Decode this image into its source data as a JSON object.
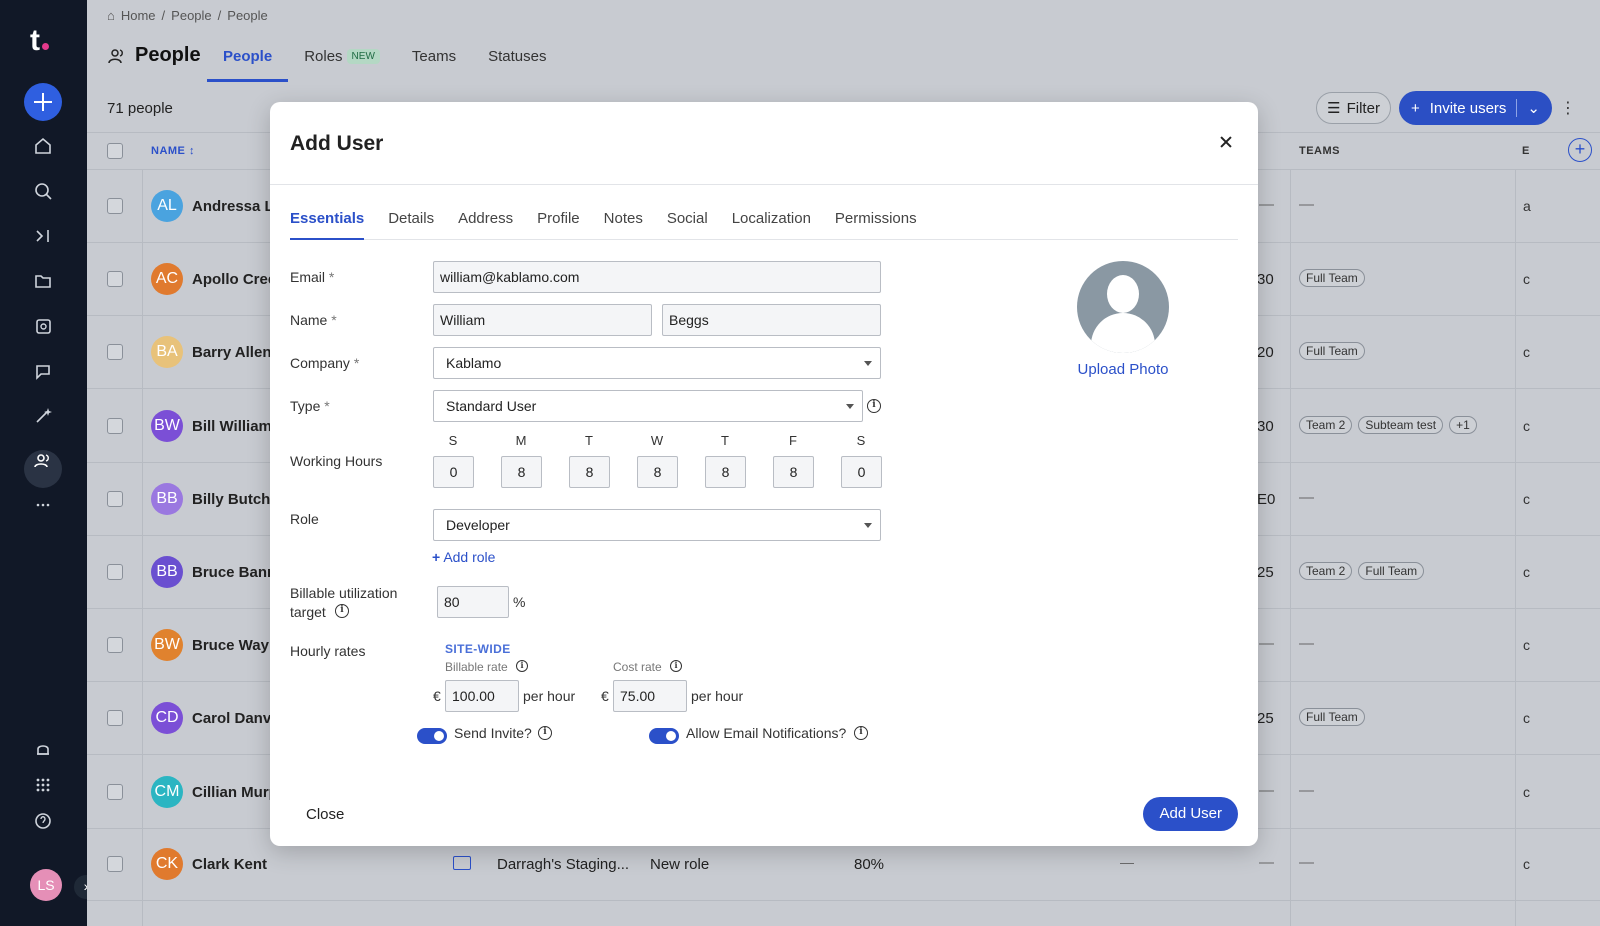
{
  "breadcrumb": [
    "Home",
    "/",
    "People",
    "/",
    "People"
  ],
  "header": {
    "title": "People"
  },
  "tabs": [
    {
      "label": "People"
    },
    {
      "label": "Roles",
      "badge": "NEW"
    },
    {
      "label": "Teams"
    },
    {
      "label": "Statuses"
    }
  ],
  "toolbar": {
    "count": "71 people",
    "filter": "Filter",
    "invite": "Invite users"
  },
  "table": {
    "col_name": "NAME",
    "col_teams": "TEAMS",
    "col_e": "E",
    "rows": [
      {
        "initials": "AL",
        "name": "Andressa L",
        "color": "#4aa3df",
        "val": "",
        "teams": [],
        "dash": "—",
        "e": "a"
      },
      {
        "initials": "AC",
        "name": "Apollo Cree",
        "color": "#e07a2e",
        "val": "30",
        "teams": [
          "Full Team"
        ],
        "dash": "",
        "e": "c"
      },
      {
        "initials": "BA",
        "name": "Barry Allen",
        "color": "#e8c27a",
        "val": "20",
        "teams": [
          "Full Team"
        ],
        "dash": "",
        "e": "c"
      },
      {
        "initials": "BW",
        "name": "Bill Williams",
        "color": "#7b4fd6",
        "val": "30",
        "teams": [
          "Team 2",
          "Subteam test",
          "+1"
        ],
        "dash": "",
        "e": "c"
      },
      {
        "initials": "BB",
        "name": "Billy Butche",
        "color": "#9a78e0",
        "val": "E0",
        "teams": [],
        "dash": "—",
        "e": "c"
      },
      {
        "initials": "BB",
        "name": "Bruce Bann",
        "color": "#6a4fd0",
        "val": "25",
        "teams": [
          "Team 2",
          "Full Team"
        ],
        "dash": "",
        "e": "c"
      },
      {
        "initials": "BW",
        "name": "Bruce Wayn",
        "color": "#e0822e",
        "val": "",
        "teams": [],
        "dash": "—",
        "e": "c"
      },
      {
        "initials": "CD",
        "name": "Carol Danve",
        "color": "#7b4fd6",
        "val": "25",
        "teams": [
          "Full Team"
        ],
        "dash": "",
        "e": "c"
      },
      {
        "initials": "CM",
        "name": "Cillian Murp",
        "color": "#2bb5c2",
        "val": "",
        "teams": [],
        "dash": "—",
        "e": "c"
      }
    ],
    "last_row": {
      "initials": "CK",
      "name": "Clark Kent",
      "color": "#e07a2e",
      "org": "Darragh's Staging...",
      "role": "New role",
      "pct": "80%",
      "dash": "—",
      "e": "c"
    }
  },
  "user": {
    "initials": "LS"
  },
  "modal": {
    "title": "Add User",
    "tabs": [
      "Essentials",
      "Details",
      "Address",
      "Profile",
      "Notes",
      "Social",
      "Localization",
      "Permissions"
    ],
    "email_label": "Email",
    "required": "*",
    "email": "william@kablamo.com",
    "name_label": "Name",
    "first_name": "William",
    "last_name": "Beggs",
    "company_label": "Company",
    "company": "Kablamo",
    "type_label": "Type",
    "type": "Standard User",
    "hours_label": "Working Hours",
    "days": [
      "S",
      "M",
      "T",
      "W",
      "T",
      "F",
      "S"
    ],
    "hours": [
      "0",
      "8",
      "8",
      "8",
      "8",
      "8",
      "0"
    ],
    "role_label": "Role",
    "role": "Developer",
    "add_role": "Add role",
    "util_label_1": "Billable utilization",
    "util_label_2": "target",
    "util": "80",
    "percent": "%",
    "rates_label": "Hourly rates",
    "site_wide": "SITE-WIDE",
    "billable_label": "Billable rate",
    "cost_label": "Cost rate",
    "currency": "€",
    "billable_rate": "100.00",
    "cost_rate": "75.00",
    "per_hour": "per hour",
    "send_invite": "Send Invite?",
    "email_notif": "Allow Email Notifications?",
    "upload_photo": "Upload Photo",
    "close": "Close",
    "submit": "Add User"
  }
}
